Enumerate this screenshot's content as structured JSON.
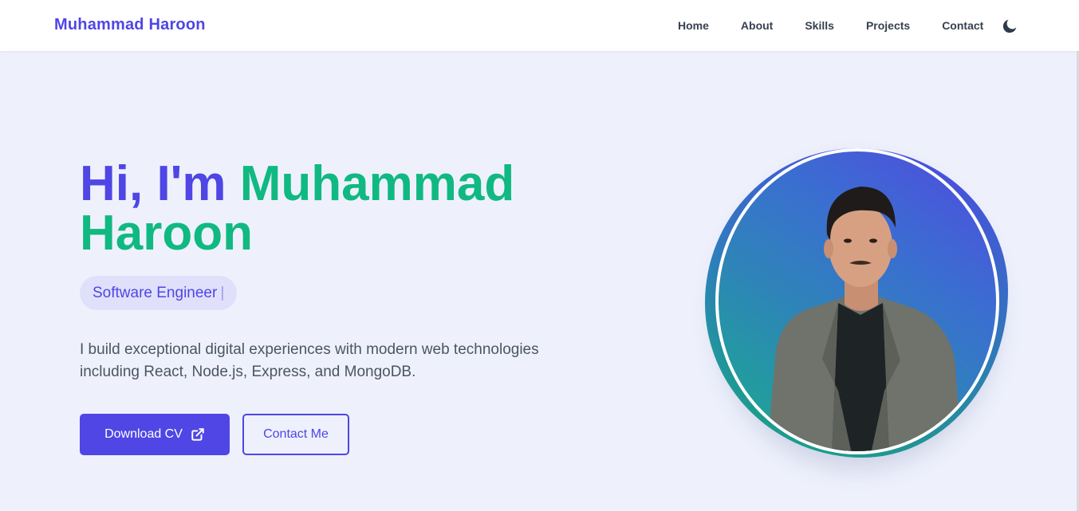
{
  "nav": {
    "brand": "Muhammad Haroon",
    "links": [
      "Home",
      "About",
      "Skills",
      "Projects",
      "Contact"
    ],
    "theme_icon": "moon-icon"
  },
  "hero": {
    "greeting": "Hi, I'm ",
    "name_line1": "Muhammad",
    "name_line2": "Haroon",
    "role": "Software Engineer",
    "cursor": "|",
    "description": "I build exceptional digital experiences with modern web technologies including React, Node.js, Express, and MongoDB.",
    "download_label": "Download CV",
    "download_icon": "external-link-icon",
    "contact_label": "Contact Me"
  },
  "colors": {
    "primary": "#4f46e5",
    "accent": "#10b981",
    "background": "#eef1fc",
    "text": "#4b5563"
  }
}
